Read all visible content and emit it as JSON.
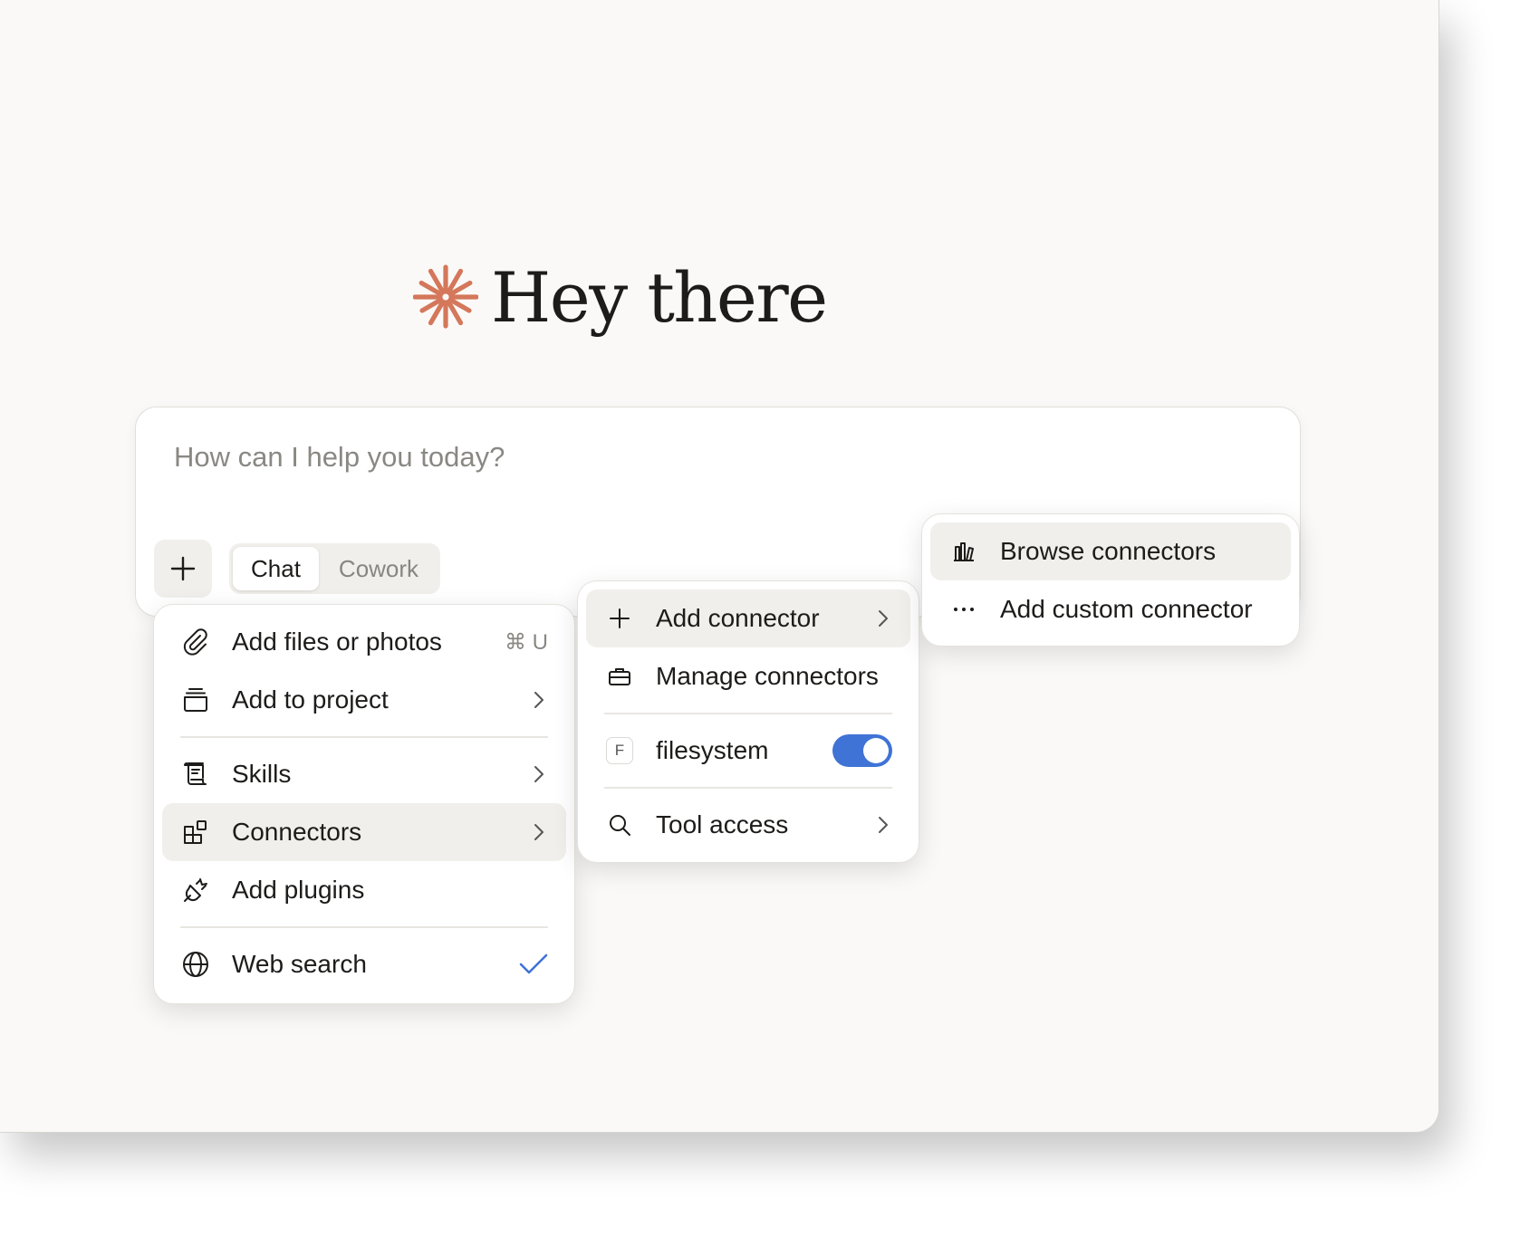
{
  "greeting": {
    "text": "Hey there",
    "logo_color": "#d4775a"
  },
  "composer": {
    "placeholder": "How can I help you today?",
    "modes": {
      "active": "Chat",
      "inactive": "Cowork"
    }
  },
  "menu_main": {
    "items": [
      {
        "label": "Add files or photos",
        "icon": "paperclip-icon",
        "shortcut": "⌘ U"
      },
      {
        "label": "Add to project",
        "icon": "project-icon"
      },
      {
        "label": "Skills",
        "icon": "scroll-icon"
      },
      {
        "label": "Connectors",
        "icon": "connectors-icon",
        "highlighted": true
      },
      {
        "label": "Add plugins",
        "icon": "plug-icon"
      },
      {
        "label": "Web search",
        "icon": "globe-icon",
        "checked": true
      }
    ]
  },
  "menu_connectors": {
    "items": [
      {
        "label": "Add connector",
        "icon": "plus-icon",
        "highlighted": true
      },
      {
        "label": "Manage connectors",
        "icon": "briefcase-icon"
      },
      {
        "label": "filesystem",
        "badge": "F",
        "enabled": true
      },
      {
        "label": "Tool access",
        "icon": "search-icon"
      }
    ]
  },
  "menu_add_connector": {
    "items": [
      {
        "label": "Browse connectors",
        "icon": "library-icon",
        "highlighted": true
      },
      {
        "label": "Add custom connector",
        "icon": "ellipsis-icon"
      }
    ]
  },
  "colors": {
    "accent_blue": "#3f73d6",
    "brand_orange": "#d4775a"
  }
}
